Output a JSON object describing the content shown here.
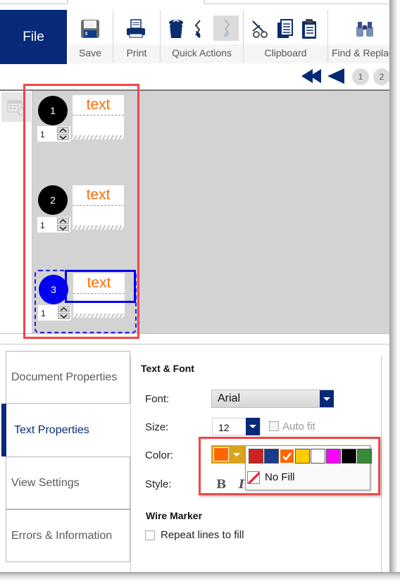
{
  "ribbon": {
    "file_label": "File",
    "groups": [
      {
        "label": "Save",
        "icons": [
          "save-icon"
        ]
      },
      {
        "label": "Print",
        "icons": [
          "print-icon"
        ]
      },
      {
        "label": "Quick Actions",
        "icons": [
          "delete-icon",
          "undo-icon",
          "redo-icon"
        ]
      },
      {
        "label": "Clipboard",
        "icons": [
          "cut-icon",
          "copy-icon",
          "paste-icon"
        ]
      },
      {
        "label": "Find & Replace",
        "icons": [
          "binoculars-icon"
        ]
      }
    ]
  },
  "page_nav": {
    "first_icon": "first-page-icon",
    "prev_icon": "prev-page-icon",
    "pages": [
      "1",
      "2"
    ]
  },
  "canvas": {
    "labels": [
      {
        "number": "1",
        "text": "text",
        "quantity": "1",
        "selected": false
      },
      {
        "number": "2",
        "text": "text",
        "quantity": "1",
        "selected": false
      },
      {
        "number": "3",
        "text": "text",
        "quantity": "1",
        "selected": true
      }
    ]
  },
  "side_tabs": [
    {
      "label": "Document Properties",
      "active": false
    },
    {
      "label": "Text Properties",
      "active": true
    },
    {
      "label": "View Settings",
      "active": false
    },
    {
      "label": "Errors & Information",
      "active": false
    }
  ],
  "text_font": {
    "section_title": "Text & Font",
    "font_label": "Font:",
    "font_value": "Arial",
    "size_label": "Size:",
    "size_value": "12",
    "autofit_label": "Auto fit",
    "autofit_checked": false,
    "color_label": "Color:",
    "selected_color": "#ff6600",
    "style_label": "Style:",
    "bold_label": "B",
    "italic_label": "I",
    "palette": [
      "#cc2222",
      "#1a3a8c",
      "#ff6600",
      "#ffcc00",
      "#ffffff",
      "#ff00ff",
      "#000000",
      "#3a8a3a"
    ],
    "no_fill_label": "No Fill"
  },
  "wire_marker": {
    "section_title": "Wire Marker",
    "repeat_label": "Repeat lines to fill",
    "repeat_checked": false
  },
  "colors": {
    "brand": "#062a78",
    "highlight": "#f24646",
    "selection": "#0000ff",
    "label_text": "#ff6a00"
  }
}
